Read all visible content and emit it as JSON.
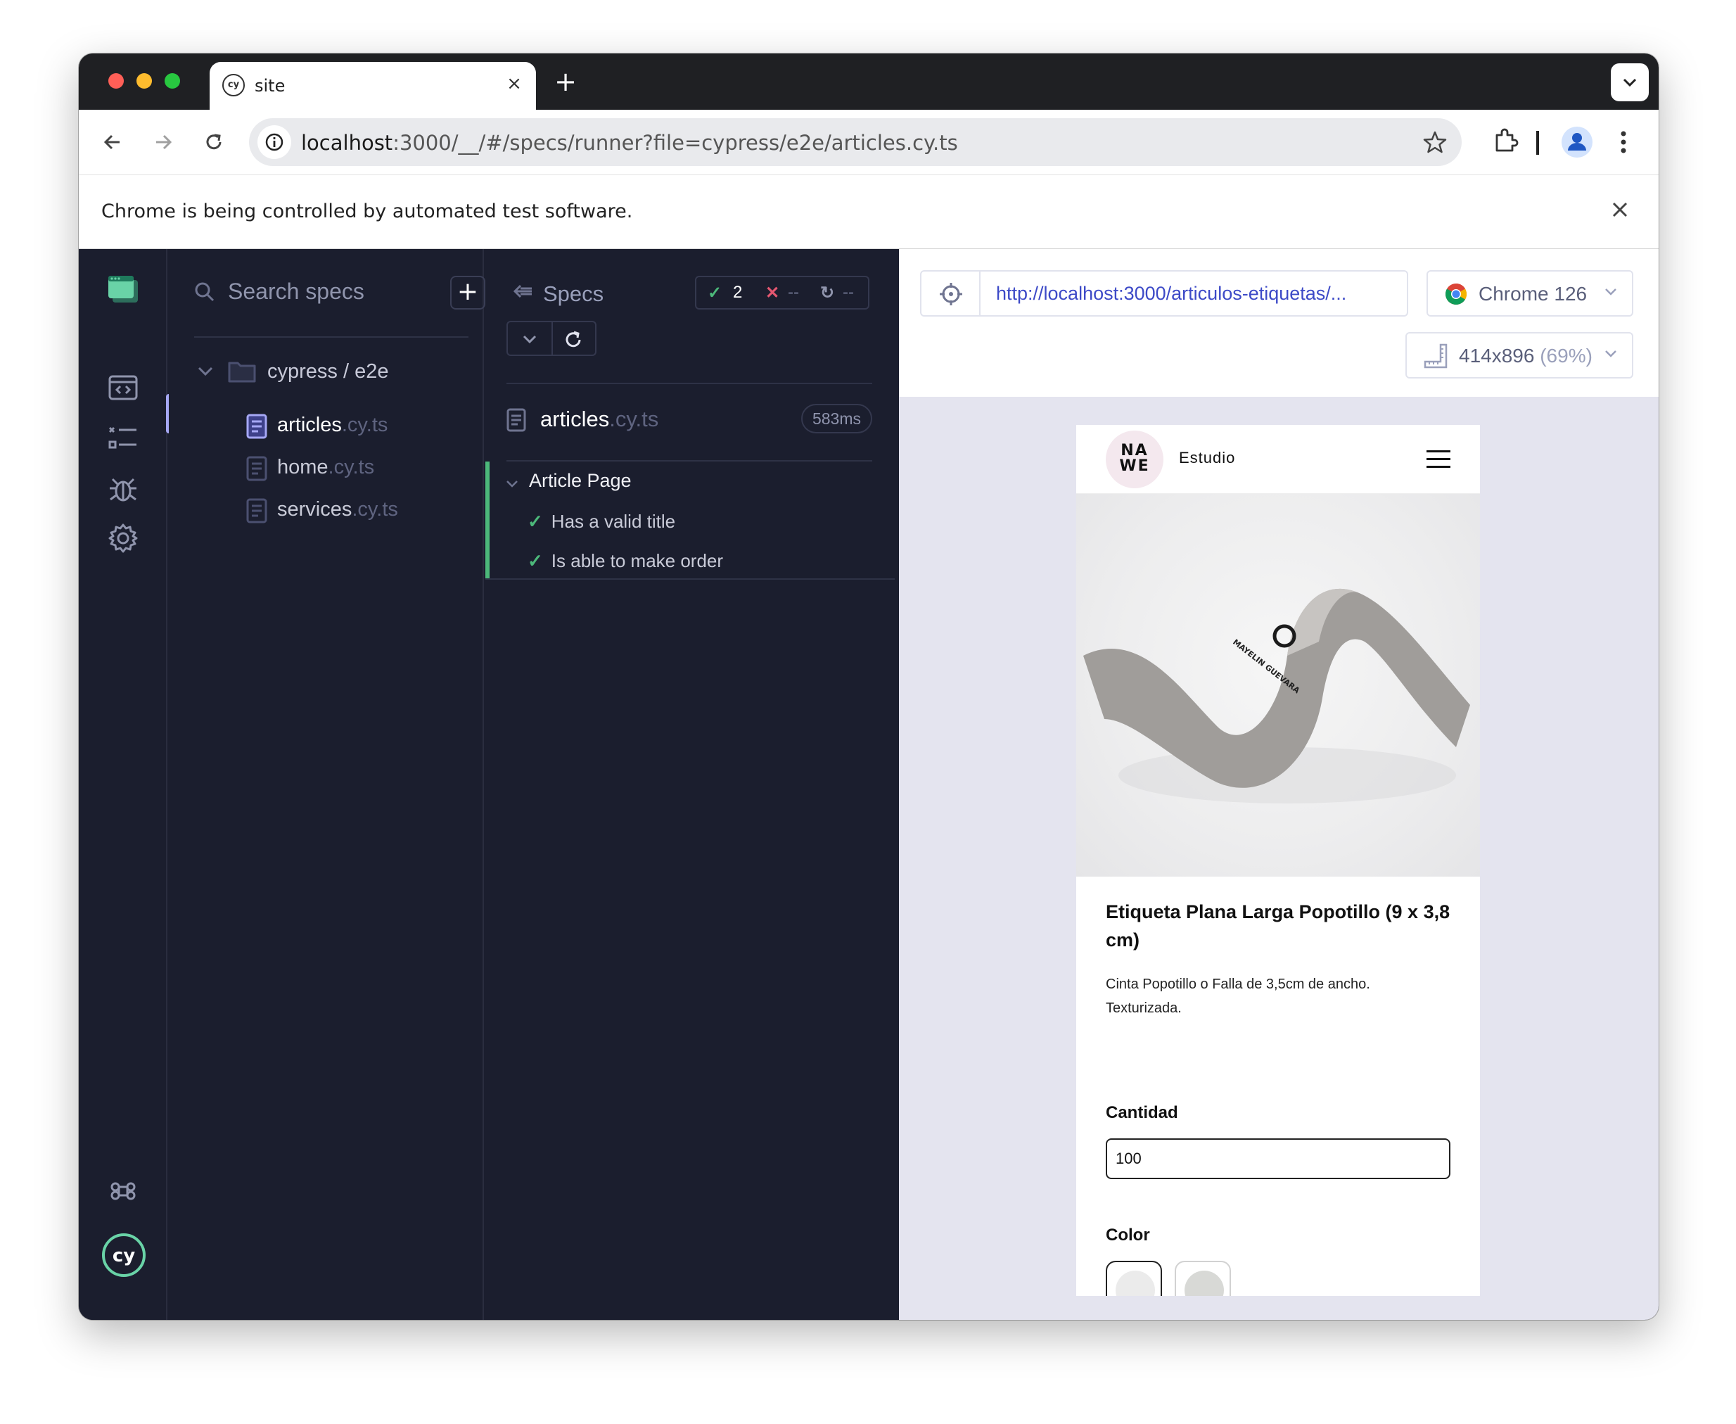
{
  "tab": {
    "title": "site",
    "favicon": "cy"
  },
  "address_bar": {
    "host": "localhost",
    "path": ":3000/__/#/specs/runner?file=cypress/e2e/articles.cy.ts"
  },
  "infobar": {
    "message": "Chrome is being controlled by automated test software."
  },
  "specs_panel": {
    "search_placeholder": "Search specs",
    "add_label": "+",
    "folder": "cypress / e2e",
    "files": [
      {
        "base": "articles",
        "ext": ".cy.ts",
        "active": true
      },
      {
        "base": "home",
        "ext": ".cy.ts",
        "active": false
      },
      {
        "base": "services",
        "ext": ".cy.ts",
        "active": false
      }
    ]
  },
  "reporter": {
    "specs_label": "Specs",
    "passed": "2",
    "failed": "--",
    "pending": "--",
    "file_base": "articles",
    "file_ext": ".cy.ts",
    "duration": "583ms",
    "suite": "Article Page",
    "tests": [
      "Has a valid title",
      "Is able to make order"
    ]
  },
  "aut_header": {
    "url": "http://localhost:3000/articulos-etiquetas/...",
    "browser": "Chrome 126",
    "viewport": "414x896",
    "viewport_scale": "(69%)"
  },
  "site": {
    "logo_line1": "NA",
    "logo_line2": "WE",
    "brand": "Estudio",
    "product_title": "Etiqueta Plana Larga Popotillo (9 x 3,8 cm)",
    "product_desc": "Cinta Popotillo o Falla de 3,5cm de ancho. Texturizada.",
    "qty_label": "Cantidad",
    "qty_value": "100",
    "color_label": "Color",
    "ribbon_print": "MAYELIN GUEVARA",
    "swatch_colors": [
      "#ebebeb",
      "#d8d9d6"
    ]
  },
  "colors": {
    "app_bg": "#1b1e2e",
    "pass": "#4cb87a",
    "fail": "#e45770",
    "accent": "#a6a8f5",
    "url_blue": "#3d4ac7"
  }
}
